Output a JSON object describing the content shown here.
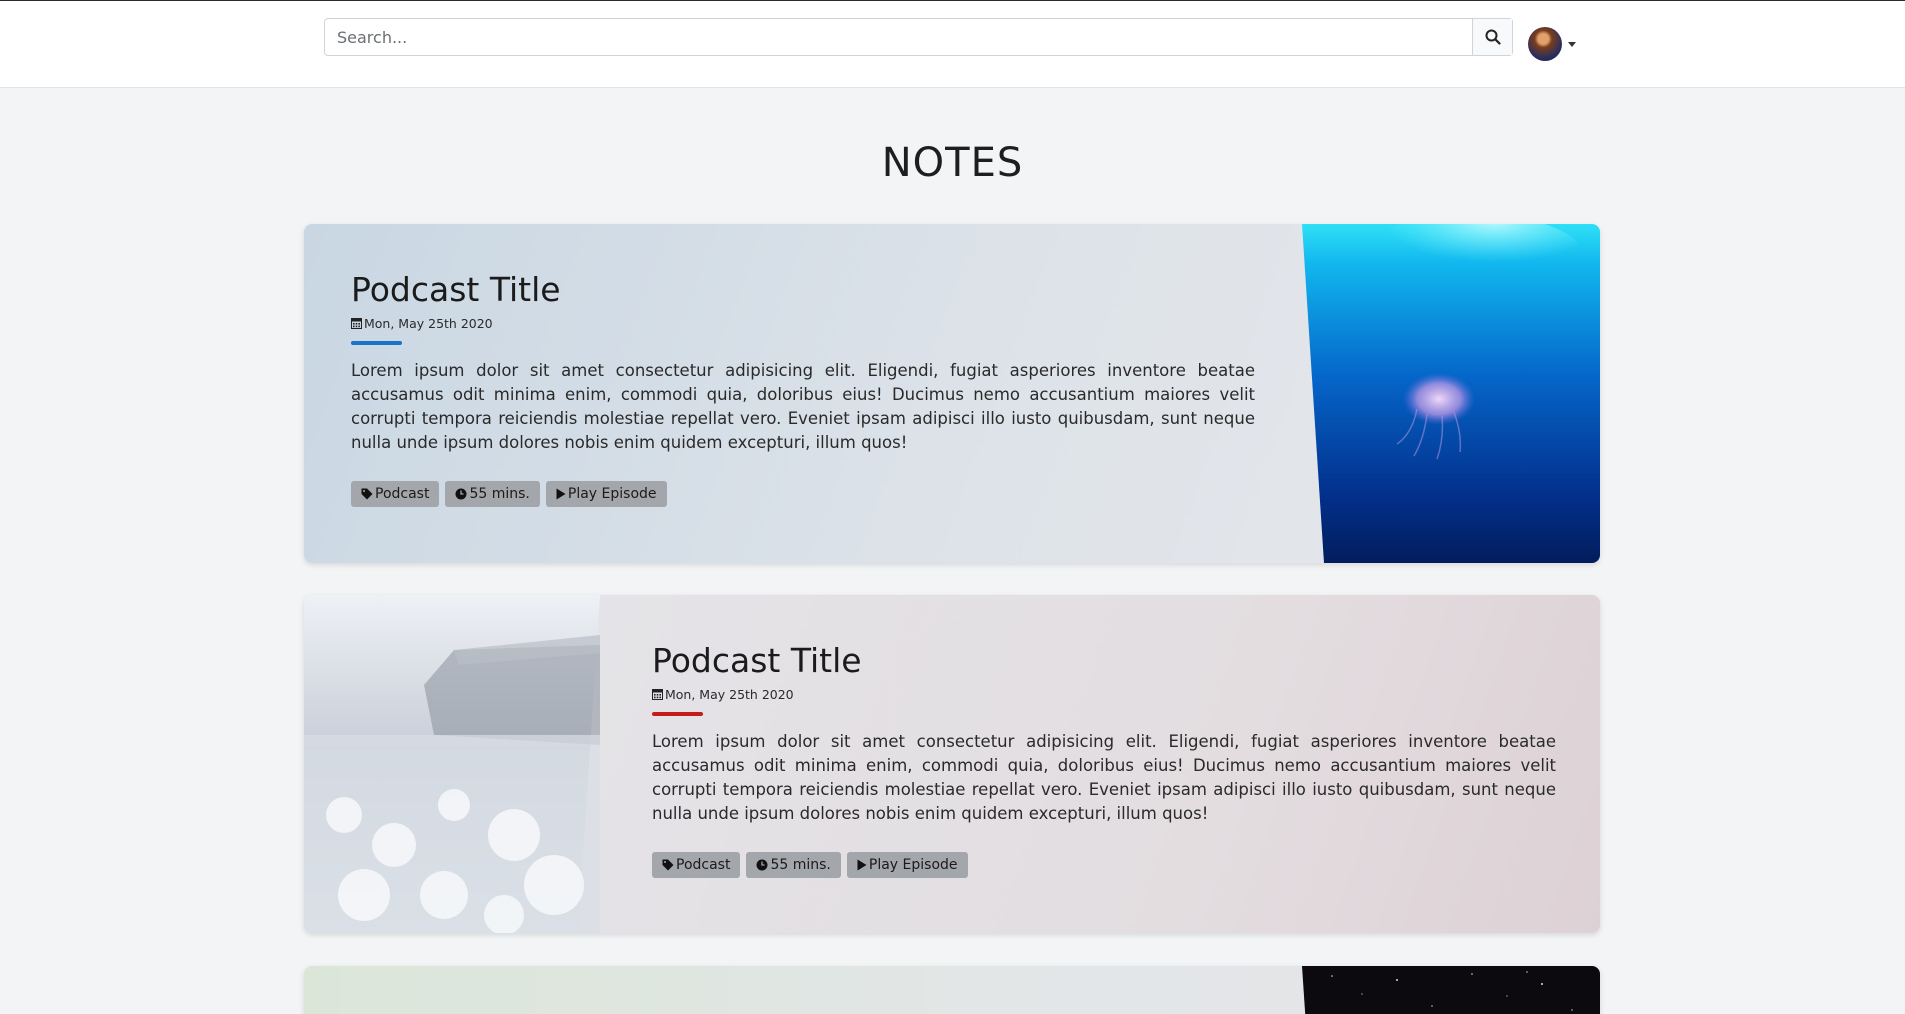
{
  "search": {
    "placeholder": "Search..."
  },
  "page": {
    "heading": "NOTES"
  },
  "cards": [
    {
      "title": "Podcast Title",
      "date": "Mon, May 25th 2020",
      "accent": "#1a73c7",
      "text": "Lorem ipsum dolor sit amet consectetur adipisicing elit. Eligendi, fugiat asperiores inventore beatae accusamus odit minima enim, commodi quia, doloribus eius! Ducimus nemo accusantium maiores velit corrupti tempora reiciendis molestiae repellat vero. Eveniet ipsam adipisci illo iusto quibusdam, sunt neque nulla unde ipsum dolores nobis enim quidem excepturi, illum quos!",
      "tags": {
        "category": "Podcast",
        "duration": "55 mins.",
        "play": "Play Episode"
      },
      "image": "jellyfish-underwater"
    },
    {
      "title": "Podcast Title",
      "date": "Mon, May 25th 2020",
      "accent": "#c41b1b",
      "text": "Lorem ipsum dolor sit amet consectetur adipisicing elit. Eligendi, fugiat asperiores inventore beatae accusamus odit minima enim, commodi quia, doloribus eius! Ducimus nemo accusantium maiores velit corrupti tempora reiciendis molestiae repellat vero. Eveniet ipsam adipisci illo iusto quibusdam, sunt neque nulla unde ipsum dolores nobis enim quidem excepturi, illum quos!",
      "tags": {
        "category": "Podcast",
        "duration": "55 mins.",
        "play": "Play Episode"
      },
      "image": "frosted-field-house"
    },
    {
      "image": "starry-night-sky"
    }
  ],
  "icons": {
    "search": "search-icon",
    "calendar": "calendar-icon",
    "tag": "tag-icon",
    "clock": "clock-icon",
    "play": "play-icon",
    "caret": "caret-down-icon"
  }
}
